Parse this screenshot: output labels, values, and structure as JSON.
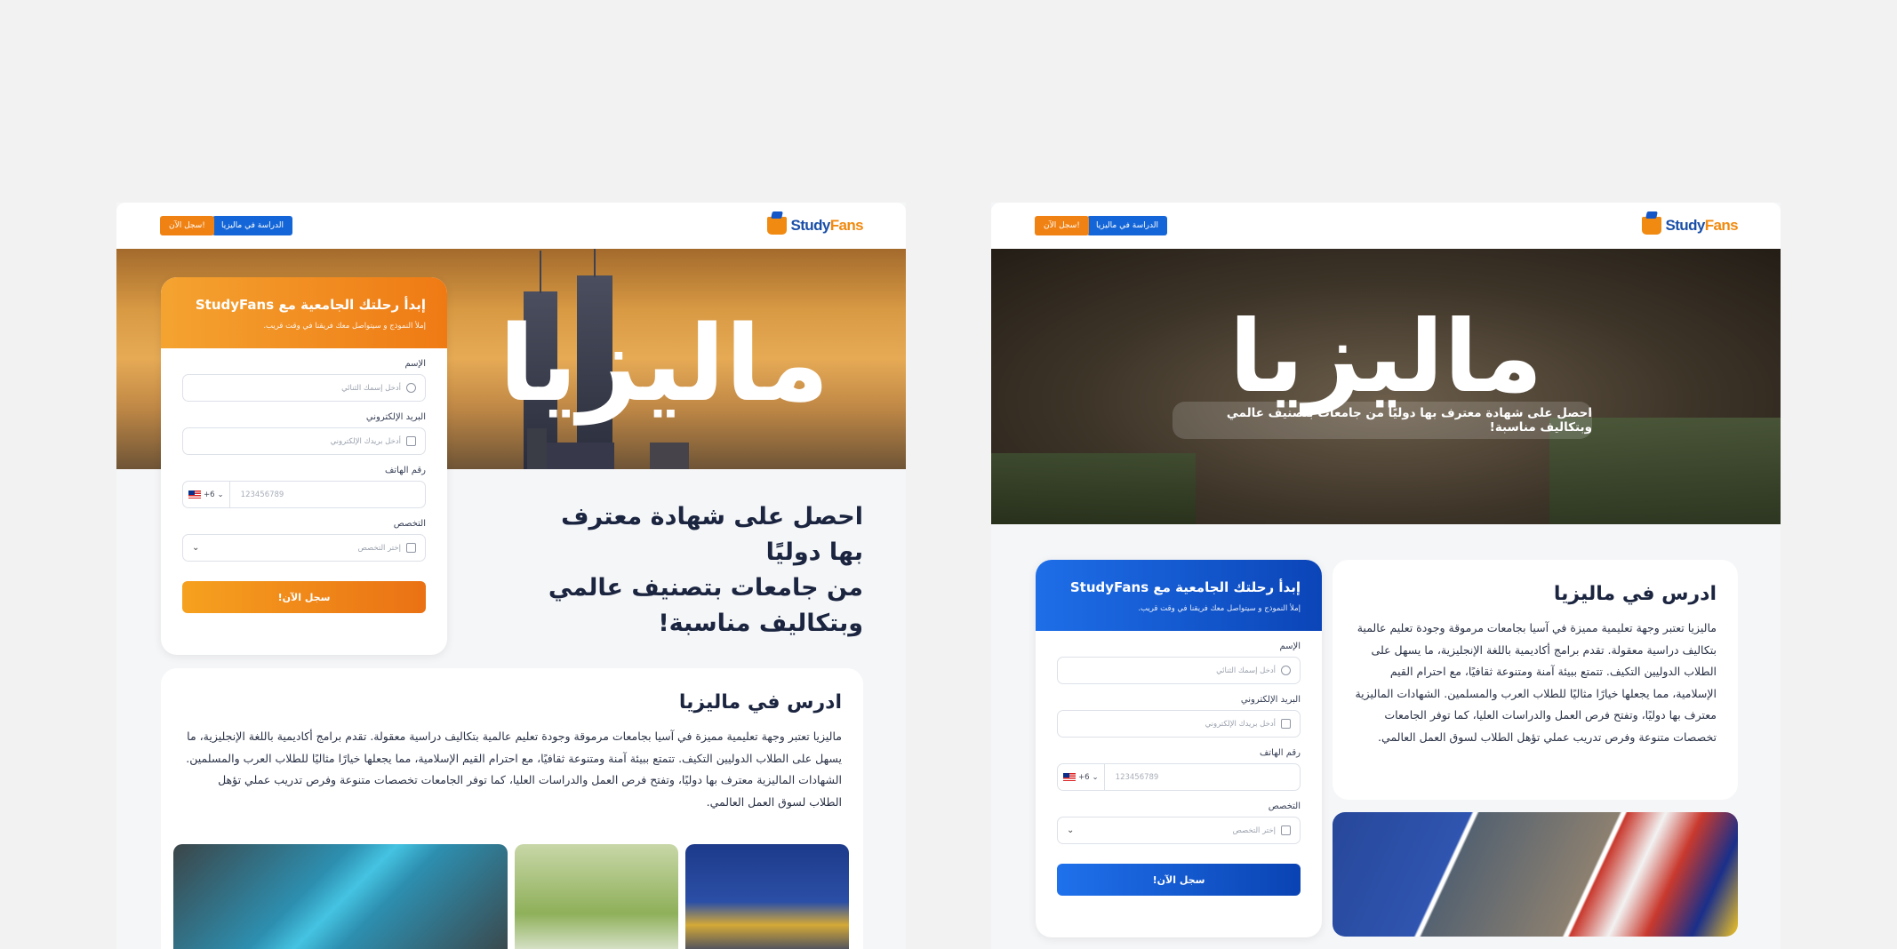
{
  "brand": {
    "logo_main": "Study",
    "logo_accent": "Fans"
  },
  "nav": {
    "study_button": "الدراسة في ماليزيا",
    "register_button": "سجل الآن!"
  },
  "hero": {
    "title": "ماليزيا",
    "subtitle": "احصل على شهادة معترف بها دوليًا من جامعات بتصنيف عالمي وبتكاليف مناسبة!"
  },
  "form": {
    "title": "إبدأ رحلتك الجامعية مع StudyFans",
    "subtitle": "إملأ النموذج و سيتواصل معك فريقنا في وقت قريب.",
    "name_label": "الإسم",
    "name_placeholder": "أدخل إسمك الثنائي",
    "email_label": "البريد الإلكتروني",
    "email_placeholder": "أدخل بريدك الإلكتروني",
    "phone_label": "رقم الهاتف",
    "phone_code": "+6",
    "phone_placeholder": "123456789",
    "major_label": "التخصص",
    "major_placeholder": "إختر التخصص",
    "submit": "سجل الآن!"
  },
  "promo": {
    "line1": "احصل على شهادة معترف بها دوليًا",
    "line2": "من جامعات بتصنيف عالمي",
    "line3": "وبتكاليف مناسبة!"
  },
  "info": {
    "title": "ادرس في ماليزيا",
    "text": "ماليزيا تعتبر وجهة تعليمية مميزة في آسيا بجامعات مرموقة وجودة تعليم عالمية بتكاليف دراسية معقولة. تقدم برامج أكاديمية باللغة الإنجليزية، ما يسهل على الطلاب الدوليين التكيف. تتمتع ببيئة آمنة ومتنوعة ثقافيًا، مع احترام القيم الإسلامية، مما يجعلها خيارًا مثاليًا للطلاب العرب والمسلمين. الشهادات الماليزية معترف بها دوليًا، وتفتح فرص العمل والدراسات العليا، كما توفر الجامعات تخصصات متنوعة وفرص تدريب عملي تؤهل الطلاب لسوق العمل العالمي."
  },
  "colors": {
    "orange": "#f08214",
    "blue": "#1466d8",
    "navy_text": "#1b2540",
    "background": "#f2f2f2"
  }
}
